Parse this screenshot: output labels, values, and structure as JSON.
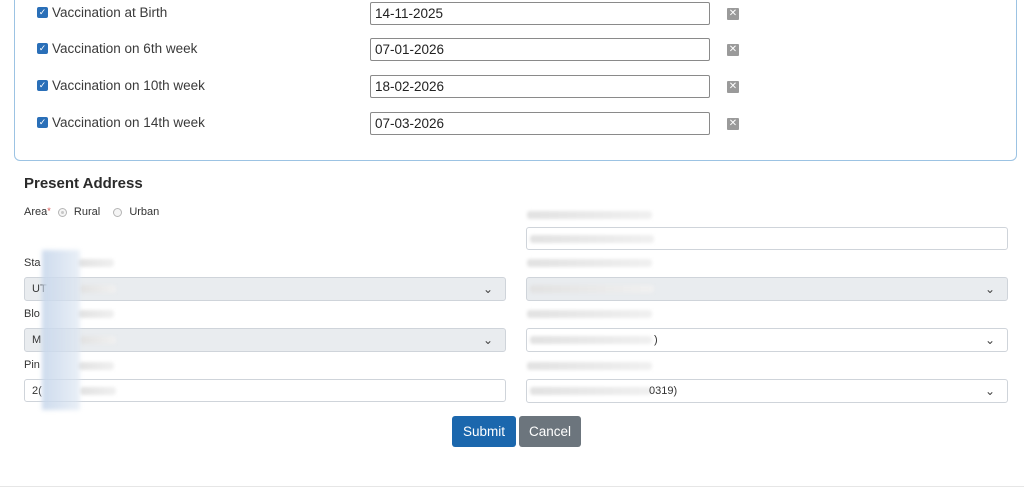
{
  "vaccinations": [
    {
      "label": "Vaccination at Birth",
      "date": "14-11-2025",
      "checked": true
    },
    {
      "label": "Vaccination on 6th week",
      "date": "07-01-2026",
      "checked": true
    },
    {
      "label": "Vaccination on 10th week",
      "date": "18-02-2026",
      "checked": true
    },
    {
      "label": "Vaccination on 14th week",
      "date": "07-03-2026",
      "checked": true
    }
  ],
  "icons": {
    "checkbox": "check-icon",
    "clear": "close-icon",
    "dropdown": "chevron-down-icon"
  },
  "address": {
    "title": "Present Address",
    "area_label": "Area",
    "required_mark": "*",
    "area_options": [
      "Rural",
      "Urban"
    ],
    "area_selected": "Rural",
    "state_label": "Sta",
    "state_value": "UT",
    "right_select_partial": ")",
    "block_label": "Blo",
    "block_value": "M",
    "pincode_label": "Pin",
    "pincode_value": "2(",
    "right_last_select_partial": "0319)"
  },
  "buttons": {
    "submit": "Submit",
    "cancel": "Cancel"
  },
  "colors": {
    "primary": "#1b67ad",
    "secondary": "#6c757d",
    "border_accent": "#9cc3e3"
  }
}
